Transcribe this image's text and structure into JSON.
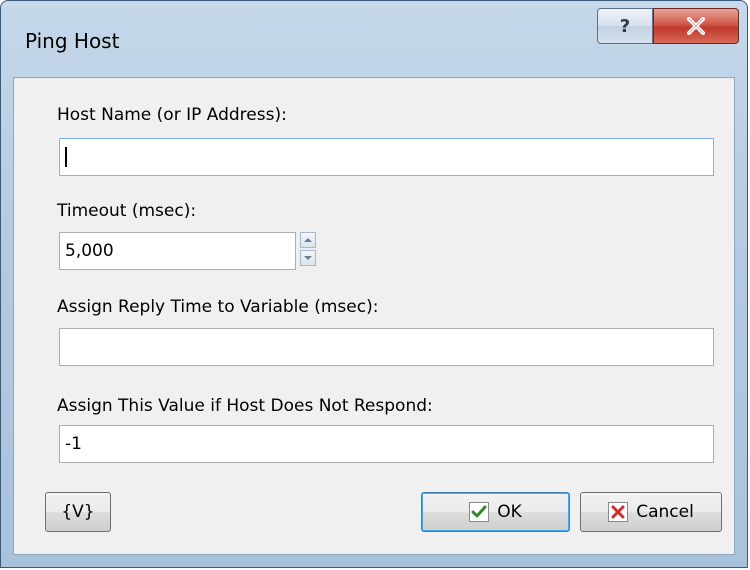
{
  "window": {
    "title": "Ping Host",
    "help_label": "?",
    "close_icon": "close-x-icon"
  },
  "form": {
    "host": {
      "label": "Host Name (or IP Address):",
      "value": ""
    },
    "timeout": {
      "label": "Timeout (msec):",
      "value": "5,000"
    },
    "reply_time": {
      "label": "Assign Reply Time to Variable (msec):",
      "value": ""
    },
    "no_response": {
      "label": "Assign This Value if Host Does Not Respond:",
      "value": "-1"
    }
  },
  "buttons": {
    "variables_label": "{V}",
    "ok_label": "OK",
    "ok_icon": "checkmark-icon",
    "cancel_label": "Cancel",
    "cancel_icon": "cancel-x-icon"
  },
  "colors": {
    "accent_focus": "#7eb4ea",
    "close_red": "#c0392b",
    "ok_check_green": "#2e8b2e",
    "cancel_red": "#d22b2b"
  }
}
